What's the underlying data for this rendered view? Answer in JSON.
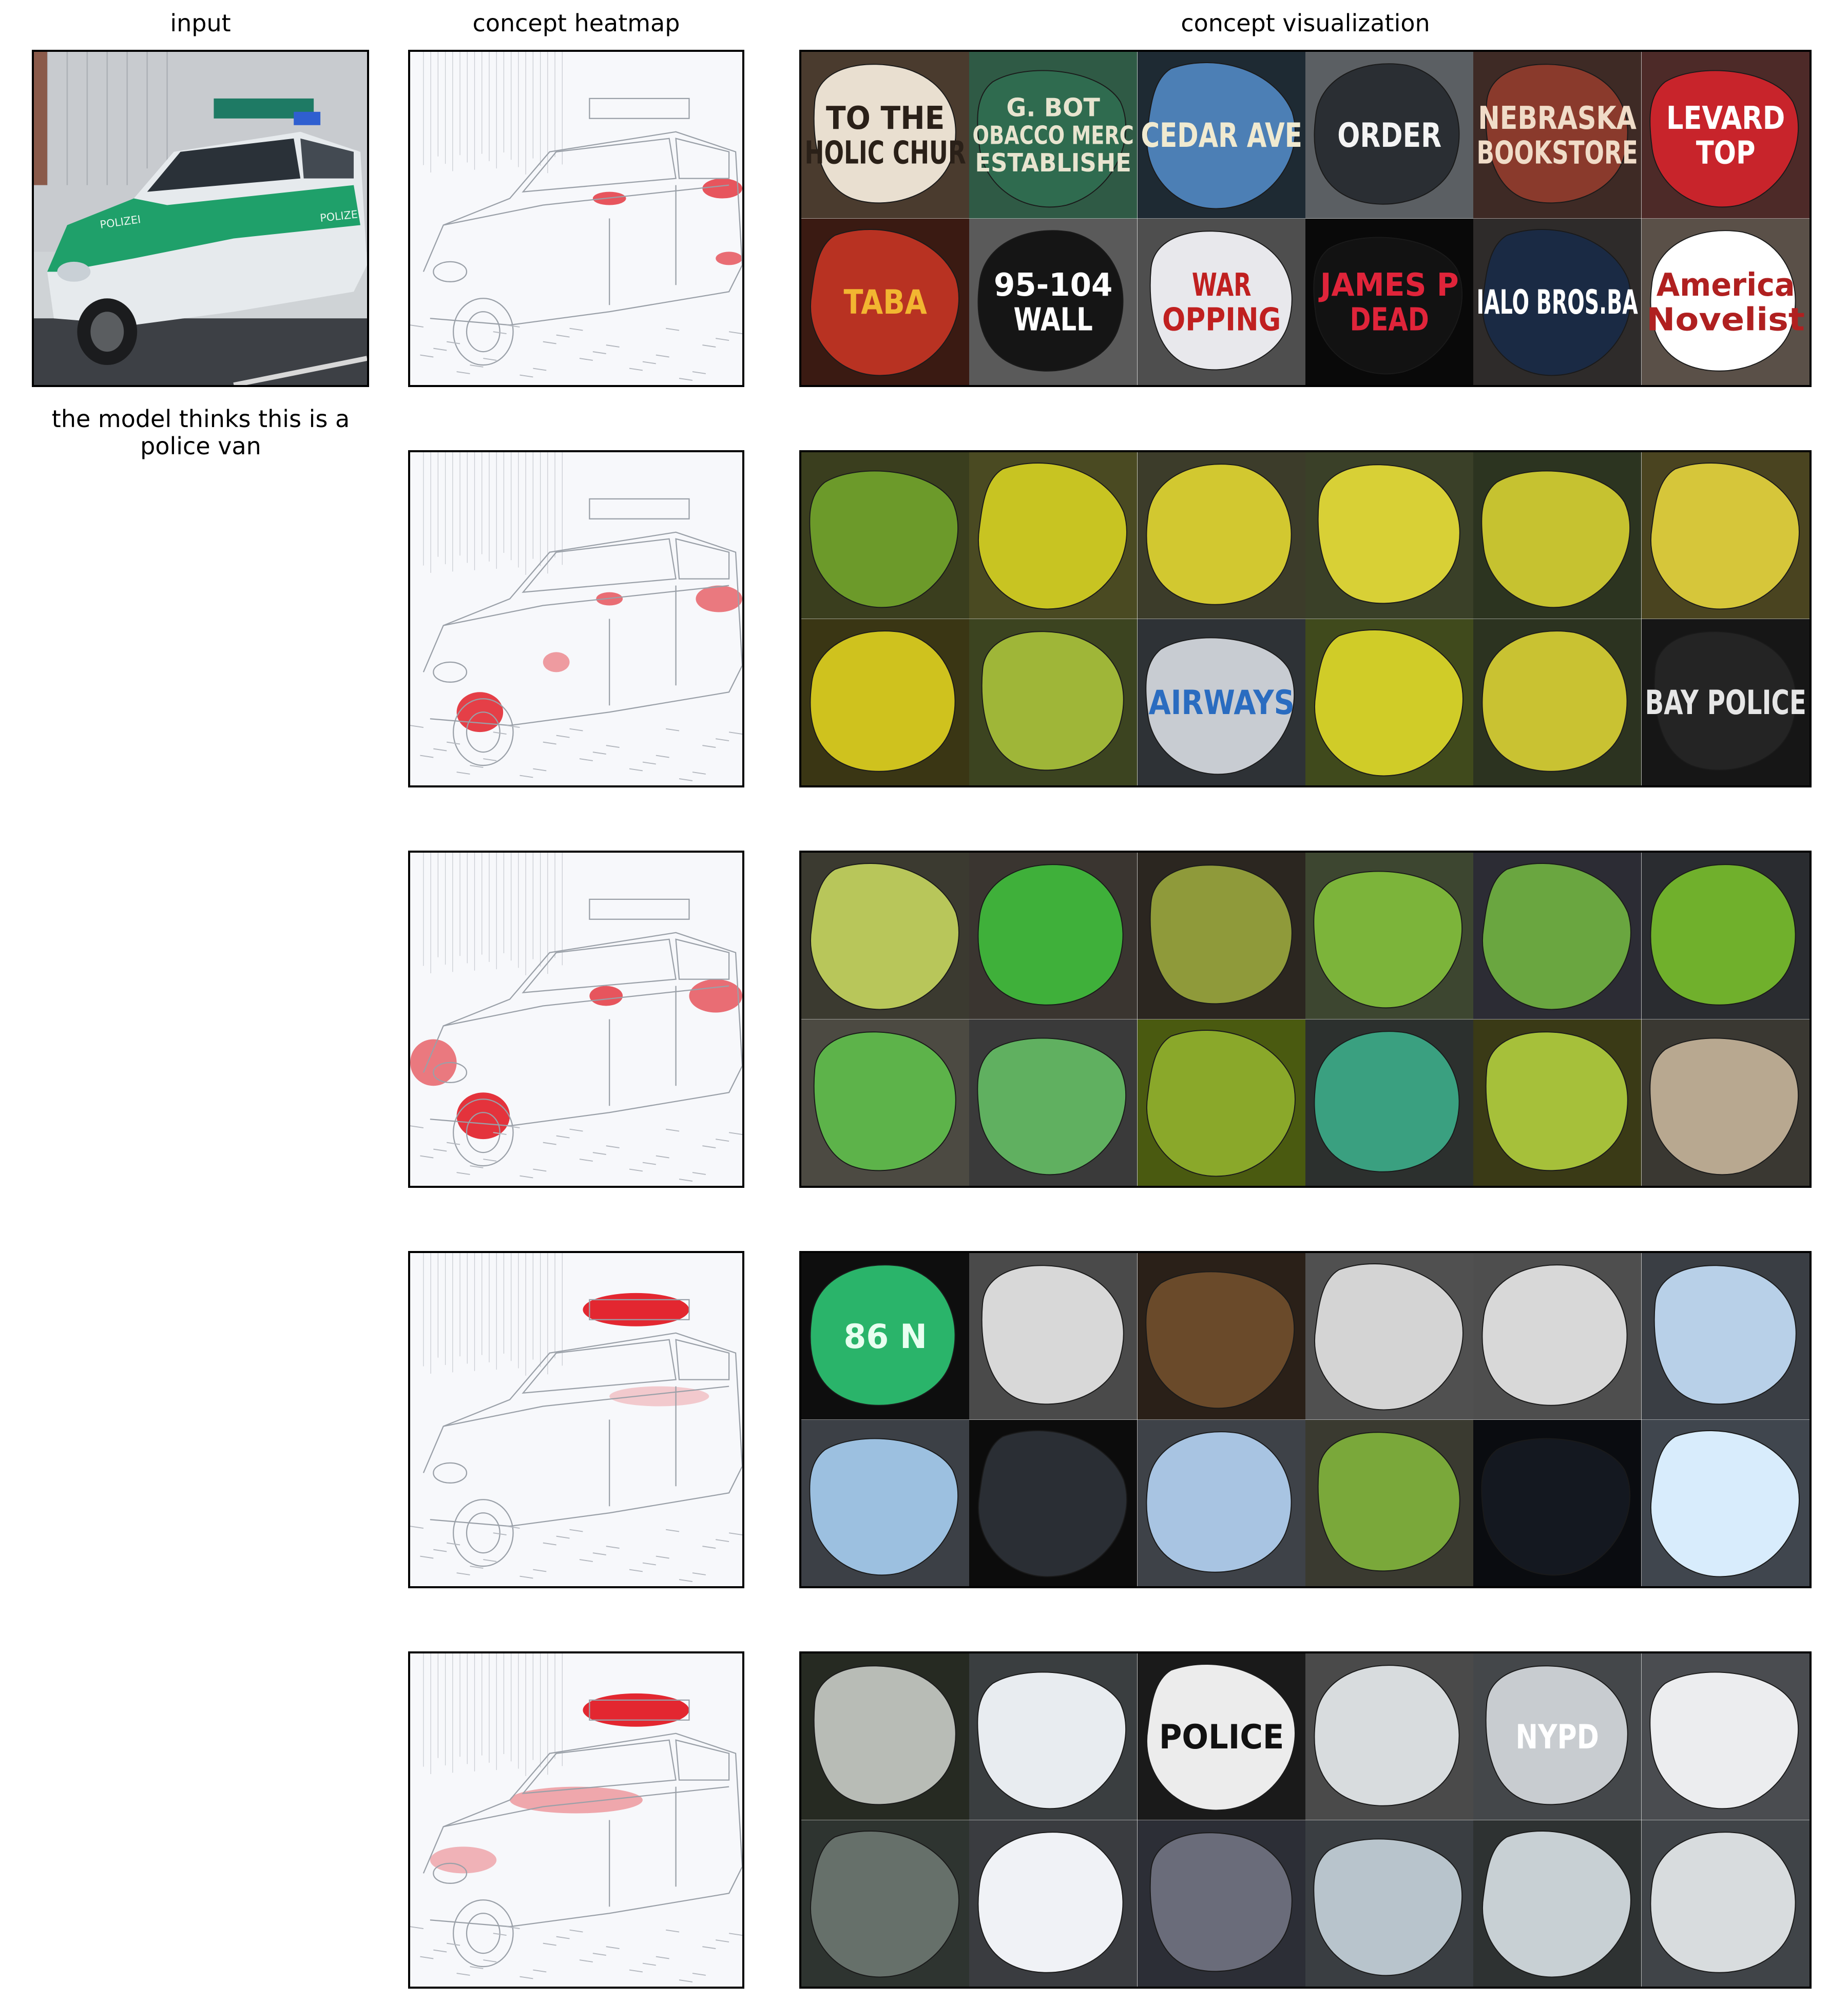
{
  "headers": {
    "input": "input",
    "heatmap": "concept heatmap",
    "visualization": "concept visualization"
  },
  "prediction_caption": "the model thinks this is a police van",
  "input_image": {
    "subject": "police car",
    "door_text": "POLIZEI",
    "colors": {
      "body": "#e8ecef",
      "stripe": "#1fa06a",
      "lightbar": "#1e7a64",
      "siren": "#2f5fd0"
    }
  },
  "heatmap_accent": "#e0101a",
  "concept_rows": [
    {
      "heatmap_focus": "door lettering",
      "tiles": [
        {
          "bg": "#4a3b2e",
          "blob": "#e9dfd0",
          "text": "TO THE\nHOLIC CHUR",
          "fg": "#2a2018"
        },
        {
          "bg": "#2f5a45",
          "blob": "#2f6b4f",
          "text": "G. BOT\nOBACCO MERC\nESTABLISHE",
          "fg": "#e8e4cf"
        },
        {
          "bg": "#1e2a33",
          "blob": "#4c7fb5",
          "text": "CEDAR AVE",
          "fg": "#f0ead0"
        },
        {
          "bg": "#5b5f63",
          "blob": "#2a2e33",
          "text": "ORDER",
          "fg": "#f4f4f4"
        },
        {
          "bg": "#3e2a25",
          "blob": "#8a3a2c",
          "text": "NEBRASKA\nBOOKSTORE",
          "fg": "#f0dcc8"
        },
        {
          "bg": "#4d2a28",
          "blob": "#c8242b",
          "text": "LEVARD\nTOP",
          "fg": "#ffffff"
        },
        {
          "bg": "#3a1a12",
          "blob": "#b83222",
          "text": "TABA",
          "fg": "#f2b631"
        },
        {
          "bg": "#5a5a5a",
          "blob": "#151515",
          "text": "95-104\nWALL",
          "fg": "#ffffff"
        },
        {
          "bg": "#4e4e4e",
          "blob": "#e8e8ec",
          "text": "WAR\nOPPING",
          "fg": "#c02020"
        },
        {
          "bg": "#090909",
          "blob": "#121212",
          "text": "JAMES P\nDEAD",
          "fg": "#e0243a"
        },
        {
          "bg": "#2e2b2a",
          "blob": "#1a2a44",
          "text": "IALO BROS.BA",
          "fg": "#ffffff"
        },
        {
          "bg": "#5a5048",
          "blob": "#ffffff",
          "text": "America\nNovelist",
          "fg": "#b02020"
        }
      ]
    },
    {
      "heatmap_focus": "wheel arch and body edges",
      "tiles": [
        {
          "bg": "#3a3e1e",
          "blob": "#6c9a2a",
          "text": "",
          "fg": ""
        },
        {
          "bg": "#4a4a22",
          "blob": "#c8c422",
          "text": "",
          "fg": ""
        },
        {
          "bg": "#3c3c2a",
          "blob": "#d2c830",
          "text": "",
          "fg": ""
        },
        {
          "bg": "#3a4028",
          "blob": "#d8d036",
          "text": "",
          "fg": ""
        },
        {
          "bg": "#2c3420",
          "blob": "#c6c230",
          "text": "",
          "fg": ""
        },
        {
          "bg": "#4a4420",
          "blob": "#d6c63a",
          "text": "",
          "fg": ""
        },
        {
          "bg": "#3a3614",
          "blob": "#cfc21e",
          "text": "",
          "fg": ""
        },
        {
          "bg": "#3c4420",
          "blob": "#9fb638",
          "text": "",
          "fg": ""
        },
        {
          "bg": "#2e3236",
          "blob": "#c8ccd2",
          "text": "AIRWAYS",
          "fg": "#2a6cc0"
        },
        {
          "bg": "#404a1c",
          "blob": "#d0cc28",
          "text": "",
          "fg": ""
        },
        {
          "bg": "#2c3320",
          "blob": "#c9c232",
          "text": "",
          "fg": ""
        },
        {
          "bg": "#161616",
          "blob": "#242424",
          "text": "BAY POLICE",
          "fg": "#e6e6e6"
        }
      ]
    },
    {
      "heatmap_focus": "front bumper and wheel",
      "tiles": [
        {
          "bg": "#3b3a30",
          "blob": "#b8c65a",
          "text": "",
          "fg": ""
        },
        {
          "bg": "#3a3530",
          "blob": "#3fb03a",
          "text": "",
          "fg": ""
        },
        {
          "bg": "#2b2620",
          "blob": "#8f9a3a",
          "text": "",
          "fg": ""
        },
        {
          "bg": "#3d4630",
          "blob": "#7cb43a",
          "text": "",
          "fg": ""
        },
        {
          "bg": "#2c2c34",
          "blob": "#6aa640",
          "text": "",
          "fg": ""
        },
        {
          "bg": "#2a2c30",
          "blob": "#70b02c",
          "text": "",
          "fg": ""
        },
        {
          "bg": "#4c4a42",
          "blob": "#5db34a",
          "text": "",
          "fg": ""
        },
        {
          "bg": "#3a3a3a",
          "blob": "#60b060",
          "text": "",
          "fg": ""
        },
        {
          "bg": "#4a5a10",
          "blob": "#8aa82a",
          "text": "",
          "fg": ""
        },
        {
          "bg": "#2c302e",
          "blob": "#3aa080",
          "text": "",
          "fg": ""
        },
        {
          "bg": "#3a3a16",
          "blob": "#a6c03a",
          "text": "",
          "fg": ""
        },
        {
          "bg": "#3a3832",
          "blob": "#b8a890",
          "text": "",
          "fg": ""
        }
      ]
    },
    {
      "heatmap_focus": "roof light bar",
      "tiles": [
        {
          "bg": "#0e0e0e",
          "blob": "#2ab46a",
          "text": "86 N",
          "fg": "#e8fff0"
        },
        {
          "bg": "#4a4a4a",
          "blob": "#d8d8d8",
          "text": "",
          "fg": ""
        },
        {
          "bg": "#2a2018",
          "blob": "#6a4a2a",
          "text": "",
          "fg": ""
        },
        {
          "bg": "#505050",
          "blob": "#d4d4d4",
          "text": "",
          "fg": ""
        },
        {
          "bg": "#4e4e4e",
          "blob": "#d8d8d8",
          "text": "",
          "fg": ""
        },
        {
          "bg": "#3a3e44",
          "blob": "#b8d0e8",
          "text": "",
          "fg": ""
        },
        {
          "bg": "#3c4046",
          "blob": "#9cc0e0",
          "text": "",
          "fg": ""
        },
        {
          "bg": "#0c0c0c",
          "blob": "#2a2e34",
          "text": "",
          "fg": ""
        },
        {
          "bg": "#3e4248",
          "blob": "#a8c4e2",
          "text": "",
          "fg": ""
        },
        {
          "bg": "#3a3a30",
          "blob": "#7aa83a",
          "text": "",
          "fg": ""
        },
        {
          "bg": "#0a0c10",
          "blob": "#141820",
          "text": "",
          "fg": ""
        },
        {
          "bg": "#40464e",
          "blob": "#d8ecfc",
          "text": "",
          "fg": ""
        }
      ]
    },
    {
      "heatmap_focus": "roof light bar and windows",
      "tiles": [
        {
          "bg": "#262a22",
          "blob": "#b8bcb6",
          "text": "",
          "fg": ""
        },
        {
          "bg": "#3a3e40",
          "blob": "#e8ecf0",
          "text": "",
          "fg": ""
        },
        {
          "bg": "#1a1a1a",
          "blob": "#ececec",
          "text": "POLICE",
          "fg": "#111111"
        },
        {
          "bg": "#4a4a4a",
          "blob": "#d8dcde",
          "text": "",
          "fg": ""
        },
        {
          "bg": "#44474a",
          "blob": "#c8ccd0",
          "text": "NYPD",
          "fg": "#ffffff"
        },
        {
          "bg": "#4a4c50",
          "blob": "#ecedef",
          "text": "",
          "fg": ""
        },
        {
          "bg": "#2e3430",
          "blob": "#66706a",
          "text": "",
          "fg": ""
        },
        {
          "bg": "#3a3c40",
          "blob": "#f0f2f6",
          "text": "",
          "fg": ""
        },
        {
          "bg": "#2c2e36",
          "blob": "#6a6c7a",
          "text": "",
          "fg": ""
        },
        {
          "bg": "#3a3e42",
          "blob": "#b8c4cc",
          "text": "",
          "fg": ""
        },
        {
          "bg": "#2e3232",
          "blob": "#c8d0d4",
          "text": "",
          "fg": ""
        },
        {
          "bg": "#404448",
          "blob": "#d8dcde",
          "text": "",
          "fg": ""
        }
      ]
    }
  ]
}
